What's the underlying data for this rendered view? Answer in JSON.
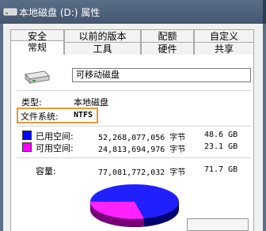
{
  "window": {
    "title": "本地磁盘 (D:) 属性"
  },
  "tabs": {
    "row1": [
      {
        "label": "安全"
      },
      {
        "label": "以前的版本"
      },
      {
        "label": "配额"
      },
      {
        "label": "自定义"
      }
    ],
    "row2": [
      {
        "label": "常规"
      },
      {
        "label": "工具"
      },
      {
        "label": "硬件"
      },
      {
        "label": "共享"
      }
    ]
  },
  "general": {
    "volume_label": "可移动磁盘",
    "type_label": "类型:",
    "type_value": "本地磁盘",
    "fs_label": "文件系统:",
    "fs_value": "NTFS",
    "used": {
      "label": "已用空间:",
      "bytes": "52,268,077,056 字节",
      "size": "48.6 GB",
      "color": "#0000ff"
    },
    "free": {
      "label": "可用空间:",
      "bytes": "24,813,694,976 字节",
      "size": "23.1 GB",
      "color": "#ff00ff"
    },
    "capacity": {
      "label": "容量:",
      "bytes": "77,081,772,032 字节",
      "size": "71.7 GB"
    }
  },
  "colors": {
    "titlebar": "#4b5e77",
    "highlight_box": "#e4983a",
    "used_space": "#0000ff",
    "free_space": "#ff00ff"
  }
}
